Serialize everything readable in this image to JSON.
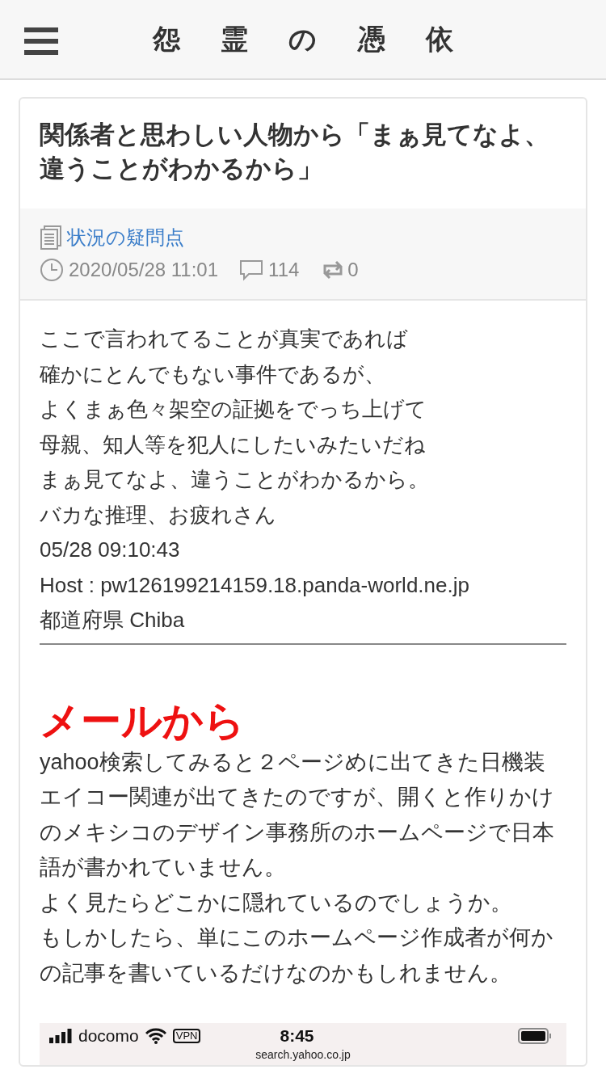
{
  "header": {
    "title": "怨 霊 の 憑 依"
  },
  "article": {
    "title": "関係者と思わしい人物から「まぁ見てなよ、違うことがわかるから」",
    "category": "状況の疑問点",
    "date": "2020/05/28 11:01",
    "comments": "114",
    "reposts": "0",
    "quote_lines": [
      "ここで言われてることが真実であれば",
      "確かにとんでもない事件であるが、",
      "よくまぁ色々架空の証拠をでっち上げて",
      "母親、知人等を犯人にしたいみたいだね",
      "まぁ見てなよ、違うことがわかるから。",
      "バカな推理、お疲れさん",
      "05/28 09:10:43",
      "Host : pw126199214159.18.panda-world.ne.jp",
      "都道府県 Chiba"
    ],
    "heading": "メールから",
    "paragraphs": [
      "yahoo検索してみると２ページめに出てきた日機装エイコー関連が出てきたのですが、開くと作りかけのメキシコのデザイン事務所のホームページで日本語が書かれていません。",
      "よく見たらどこかに隠れているのでしょうか。",
      "もしかしたら、単にこのホームページ作成者が何かの記事を書いているだけなのかもしれません。"
    ],
    "screenshot": {
      "carrier": "docomo",
      "vpn": "VPN",
      "time": "8:45",
      "url": "search.yahoo.co.jp"
    }
  }
}
